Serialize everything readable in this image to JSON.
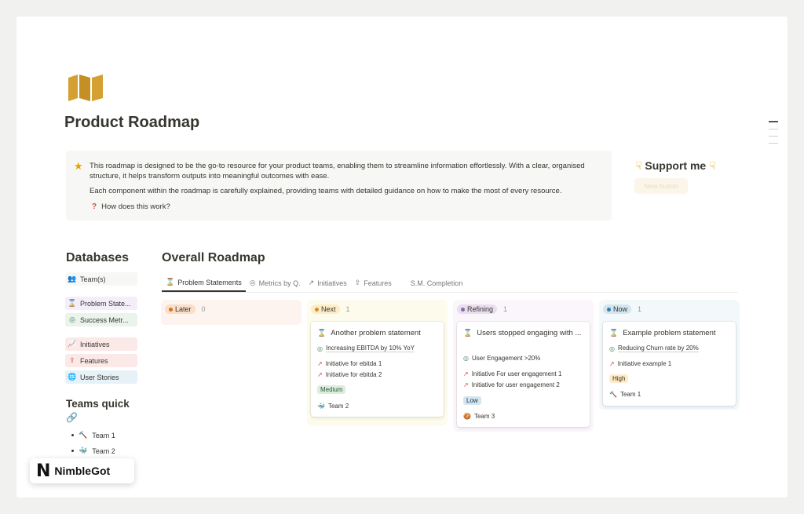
{
  "page": {
    "title": "Product Roadmap",
    "icon": "map-icon"
  },
  "callout": {
    "icon": "star-icon",
    "text": "This roadmap is designed to be the go-to resource for your product teams, enabling them to streamline information effortlessly. With a clear, organised structure, it helps transform outputs into meaningful outcomes with ease.",
    "text2": "Each component within the roadmap is carefully explained, providing teams with detailed guidance on how to make the most of every resource.",
    "toggle": "How does this work?"
  },
  "support": {
    "title": "Support me",
    "button": "New button"
  },
  "databases": {
    "title": "Databases",
    "items": [
      {
        "label": "Team(s)",
        "icon": "people-icon",
        "bg": "#f7f7f5"
      },
      {
        "label": "Problem State...",
        "icon": "hourglass-icon",
        "bg": "#f4eefa"
      },
      {
        "label": "Success Metr...",
        "icon": "target-icon",
        "bg": "#eaf3ec"
      },
      {
        "label": "Initiatives",
        "icon": "chart-icon",
        "bg": "#fbe9e8"
      },
      {
        "label": "Features",
        "icon": "share-icon",
        "bg": "#fbe9e8"
      },
      {
        "label": "User Stories",
        "icon": "globe-icon",
        "bg": "#e7f1f8"
      }
    ]
  },
  "teams_quick": {
    "title": "Teams quick",
    "link_icon": "link-icon",
    "items": [
      {
        "label": "Team 1",
        "icon": "hammer-icon"
      },
      {
        "label": "Team 2",
        "icon": "whale-icon"
      }
    ]
  },
  "roadmap": {
    "title": "Overall Roadmap",
    "tabs": [
      {
        "label": "Problem Statements",
        "icon": "hourglass-icon",
        "active": true
      },
      {
        "label": "Metrics by Q.",
        "icon": "target-icon",
        "active": false
      },
      {
        "label": "Initiatives",
        "icon": "chart-icon",
        "active": false
      },
      {
        "label": "Features",
        "icon": "share-icon",
        "active": false
      },
      {
        "label": "S.M. Completion",
        "icon": "",
        "active": false
      }
    ],
    "columns": [
      {
        "label": "Later",
        "count": "0",
        "bg": "#fdf3ef",
        "pill_bg": "#fadec9",
        "dot": "#d9730d"
      },
      {
        "label": "Next",
        "count": "1",
        "bg": "#fdfbeb",
        "pill_bg": "#fdecc8",
        "dot": "#cb912f"
      },
      {
        "label": "Refining",
        "count": "1",
        "bg": "#faf6fb",
        "pill_bg": "#e8deee",
        "dot": "#9065b0"
      },
      {
        "label": "Now",
        "count": "1",
        "bg": "#f3f8fb",
        "pill_bg": "#d3e5ef",
        "dot": "#337ea9"
      }
    ],
    "cards": [
      {
        "title": "Another problem statement",
        "metric": "Increasing EBITDA by 10% YoY",
        "initiatives": [
          "Initiative for ebitda 1",
          "Initiative for ebitda 2"
        ],
        "priority": "Medium",
        "team": "Team 2"
      },
      {
        "title": "Users stopped engaging with ...",
        "metric": "User Engagement >20%",
        "initiatives": [
          "Initiative For user engagement 1",
          "Initiative for user engagement 2"
        ],
        "priority": "Low",
        "team": "Team 3"
      },
      {
        "title": "Example problem statement",
        "metric": "Reducing Churn rate by 20%",
        "initiatives": [
          "Initiative example 1"
        ],
        "priority": "High",
        "team": "Team 1"
      }
    ]
  },
  "branding": {
    "logo_letter": "N",
    "logo_text": "NimbleGot"
  },
  "colors": {
    "accent_gold": "#d4a032",
    "tag_medium_bg": "#dbeddb",
    "tag_low_bg": "#d3e5ef",
    "tag_high_bg": "#fdecc8"
  }
}
